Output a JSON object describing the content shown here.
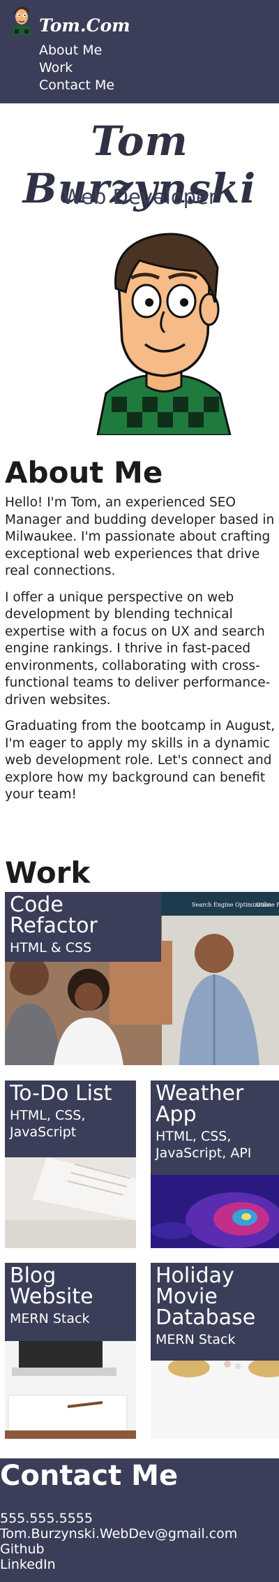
{
  "header": {
    "logo_text": "Tom.Com",
    "nav": [
      "About Me",
      "Work",
      "Contact Me"
    ]
  },
  "hero": {
    "name": "Tom Burzynski",
    "role": "Web Developer"
  },
  "about": {
    "title": "About Me",
    "paragraphs": [
      "Hello! I'm Tom, an experienced SEO Manager and budding developer based in Milwaukee. I'm passionate about crafting exceptional web experiences that drive real connections.",
      "I offer a unique perspective on web development by blending technical expertise with a focus on UX and search engine rankings. I thrive in fast-paced environments, collaborating with cross-functional teams to deliver performance-driven websites.",
      "Graduating from the bootcamp in August, I'm eager to apply my skills in a dynamic web development role. Let's connect and explore how my background can benefit your team!"
    ]
  },
  "work": {
    "title": "Work",
    "projects": [
      {
        "name": "Code Refactor",
        "tech": "HTML & CSS",
        "screenshot_text": [
          "Search Engine Optimization",
          "Online Reputation"
        ]
      },
      {
        "name": "To-Do List",
        "tech": "HTML, CSS, JavaScript"
      },
      {
        "name": "Weather App",
        "tech": "HTML, CSS, JavaScript, API"
      },
      {
        "name": "Blog Website",
        "tech": "MERN Stack"
      },
      {
        "name": "Holiday Movie Database",
        "tech": "MERN Stack"
      }
    ]
  },
  "contact": {
    "title": "Contact Me",
    "items": [
      "555.555.5555",
      "Tom.Burzynski.WebDev@gmail.com",
      "Github",
      "LinkedIn"
    ]
  },
  "colors": {
    "header_bg": "#3b3e58",
    "text": "#1e1e1e",
    "white": "#ffffff"
  },
  "icons": {
    "logo": "cartoon-avatar-icon",
    "portrait": "cartoon-portrait"
  }
}
